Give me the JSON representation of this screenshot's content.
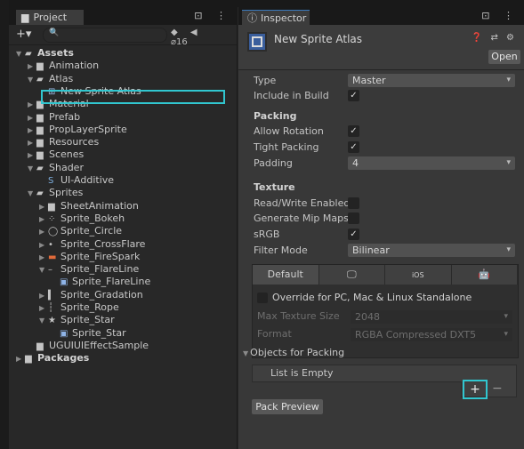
{
  "project": {
    "tab_label": "Project",
    "tab_tools": "⊡ ⋮",
    "toolbar": {
      "add_label": "+▾",
      "search_placeholder": "",
      "hidden_count": "16"
    },
    "tree": [
      {
        "label": "Assets",
        "depth": 0,
        "icon": "folder-open-icon",
        "expanded": true,
        "bold": true
      },
      {
        "label": "Animation",
        "depth": 1,
        "icon": "folder-icon",
        "expanded": false
      },
      {
        "label": "Atlas",
        "depth": 1,
        "icon": "folder-open-icon",
        "expanded": true
      },
      {
        "label": "New Sprite Atlas",
        "depth": 2,
        "icon": "sprite-atlas-icon",
        "selected": true
      },
      {
        "label": "Material",
        "depth": 1,
        "icon": "folder-icon",
        "expanded": false
      },
      {
        "label": "Prefab",
        "depth": 1,
        "icon": "folder-icon",
        "expanded": false
      },
      {
        "label": "PropLayerSprite",
        "depth": 1,
        "icon": "folder-icon",
        "expanded": false
      },
      {
        "label": "Resources",
        "depth": 1,
        "icon": "folder-icon",
        "expanded": false
      },
      {
        "label": "Scenes",
        "depth": 1,
        "icon": "folder-icon",
        "expanded": false
      },
      {
        "label": "Shader",
        "depth": 1,
        "icon": "folder-open-icon",
        "expanded": true
      },
      {
        "label": "UI-Additive",
        "depth": 2,
        "icon": "shader-icon"
      },
      {
        "label": "Sprites",
        "depth": 1,
        "icon": "folder-open-icon",
        "expanded": true
      },
      {
        "label": "SheetAnimation",
        "depth": 2,
        "icon": "folder-icon",
        "expanded": false
      },
      {
        "label": "Sprite_Bokeh",
        "depth": 2,
        "icon": "sprite-bokeh-icon",
        "expanded": false
      },
      {
        "label": "Sprite_Circle",
        "depth": 2,
        "icon": "sprite-circle-icon",
        "expanded": false
      },
      {
        "label": "Sprite_CrossFlare",
        "depth": 2,
        "icon": "sprite-crossflare-icon",
        "expanded": false
      },
      {
        "label": "Sprite_FireSpark",
        "depth": 2,
        "icon": "sprite-firespark-icon",
        "expanded": false
      },
      {
        "label": "Sprite_FlareLine",
        "depth": 2,
        "icon": "sprite-flareline-icon",
        "expanded": true
      },
      {
        "label": "Sprite_FlareLine",
        "depth": 3,
        "icon": "sprite-asset-icon"
      },
      {
        "label": "Sprite_Gradation",
        "depth": 2,
        "icon": "sprite-gradation-icon",
        "expanded": false
      },
      {
        "label": "Sprite_Rope",
        "depth": 2,
        "icon": "sprite-rope-icon",
        "expanded": false
      },
      {
        "label": "Sprite_Star",
        "depth": 2,
        "icon": "sprite-star-icon",
        "expanded": true
      },
      {
        "label": "Sprite_Star",
        "depth": 3,
        "icon": "sprite-asset-icon"
      },
      {
        "label": "UGUIUIEffectSample",
        "depth": 1,
        "icon": "folder-icon"
      },
      {
        "label": "Packages",
        "depth": 0,
        "icon": "folder-icon",
        "expanded": false,
        "bold": true
      }
    ]
  },
  "inspector": {
    "tab_label": "Inspector",
    "tab_tools": "⊡ ⋮",
    "title": "New Sprite Atlas",
    "header_icons": "❓ ⇄ ⚙",
    "open_label": "Open",
    "type_label": "Type",
    "type_value": "Master",
    "include_label": "Include in Build",
    "packing_head": "Packing",
    "allow_rotation_label": "Allow Rotation",
    "tight_packing_label": "Tight Packing",
    "padding_label": "Padding",
    "padding_value": "4",
    "texture_head": "Texture",
    "rw_label": "Read/Write Enabled",
    "mip_label": "Generate Mip Maps",
    "srgb_label": "sRGB",
    "filter_label": "Filter Mode",
    "filter_value": "Bilinear",
    "checkmark": "✓",
    "platforms": {
      "tabs": [
        "Default",
        "",
        "iOS",
        ""
      ],
      "override_label": "Override for PC, Mac & Linux Standalone",
      "max_size_label": "Max Texture Size",
      "max_size_value": "2048",
      "format_label": "Format",
      "format_value": "RGBA Compressed DXT5"
    },
    "objects_head": "Objects for Packing",
    "list_empty": "List is Empty",
    "add_label": "+",
    "remove_label": "−",
    "pack_preview_label": "Pack Preview"
  }
}
